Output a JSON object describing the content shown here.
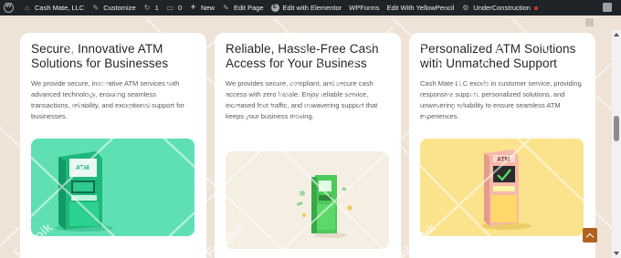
{
  "adminbar": {
    "site_name": "Cash Mate, LLC",
    "customize": "Customize",
    "updates_count": "1",
    "comments_count": "0",
    "new_label": "New",
    "edit_page": "Edit Page",
    "elementor": "Edit with Elementor",
    "wpforms": "WPForms",
    "yellowpencil": "Edit With YellowPencil",
    "under_construction": "UnderConstruction"
  },
  "cards": [
    {
      "title": "Secure, Innovative ATM Solutions for Businesses",
      "body": "We provide secure, innovative ATM services with advanced technology, ensuring seamless transactions, reliability, and exceptional support for businesses.",
      "image_bg": "#5fe0b3"
    },
    {
      "title": "Reliable, Hassle-Free Cash Access for Your Business",
      "body": "We provides secure, compliant, and secure cash access with zero hassle. Enjoy reliable service, increased foot traffic, and unwavering support that keeps your business moving.",
      "image_bg": "#f4eee3"
    },
    {
      "title": "Personalized ATM Solutions with Unmatched Support",
      "body": "Cash Mate LLC excels in customer service, providing responsive support, personalized solutions, and unwavering reliability to ensure seamless ATM experiences.",
      "image_bg": "#fae38c"
    }
  ],
  "atm_screen_label": "ATM",
  "watermark_text": "Freepik",
  "colors": {
    "page_bg": "#efe2d6",
    "adminbar_bg": "#1d2327",
    "back_to_top": "#b2621f"
  }
}
